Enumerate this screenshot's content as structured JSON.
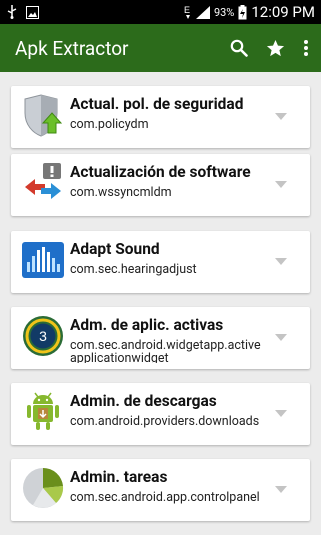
{
  "status_bar": {
    "battery": "93%",
    "time": "12:09 PM",
    "icons": [
      "usb-icon",
      "image-icon",
      "edge-network-icon",
      "signal-icon",
      "battery-icon"
    ]
  },
  "appbar": {
    "title": "Apk Extractor",
    "actions": [
      "search-icon",
      "star-icon",
      "overflow-menu-icon"
    ],
    "color": "#2c6b1b"
  },
  "apps": [
    {
      "name": "Actual. pol. de seguridad",
      "package": "com.policydm",
      "icon": "security-policy-icon"
    },
    {
      "name": "Actualización de software",
      "package": "com.wssyncmldm",
      "icon": "software-update-icon"
    },
    {
      "name": "Adapt Sound",
      "package": "com.sec.hearingadjust",
      "icon": "adapt-sound-icon"
    },
    {
      "name": "Adm. de aplic. activas",
      "package": "com.sec.android.widgetapp.active applicationwidget",
      "icon": "active-apps-icon",
      "badge": "3"
    },
    {
      "name": "Admin. de descargas",
      "package": "com.android.providers.downloads",
      "icon": "android-robot-icon"
    },
    {
      "name": "Admin. tareas",
      "package": "com.sec.android.app.controlpanel",
      "icon": "task-manager-pie-icon"
    }
  ]
}
